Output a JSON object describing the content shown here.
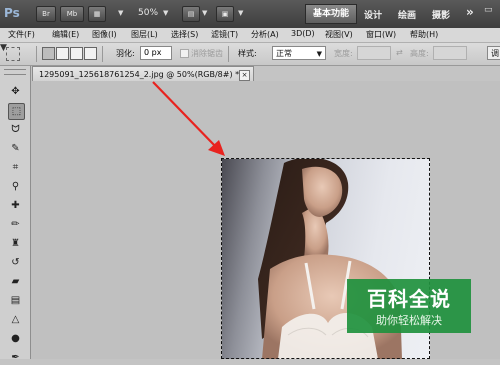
{
  "app": {
    "logo": "Ps",
    "bridge_label": "Br",
    "minibridge_label": "Mb",
    "zoom": "50%"
  },
  "workspaces": {
    "active": "基本功能",
    "items": [
      "设计",
      "绘画",
      "摄影"
    ],
    "more": "»"
  },
  "menu": {
    "items": [
      "文件(F)",
      "编辑(E)",
      "图像(I)",
      "图层(L)",
      "选择(S)",
      "滤镜(T)",
      "分析(A)",
      "3D(D)",
      "视图(V)",
      "窗口(W)",
      "帮助(H)"
    ]
  },
  "options": {
    "feather_label": "羽化:",
    "feather_value": "0 px",
    "antialias_label": "消除锯齿",
    "style_label": "样式:",
    "style_value": "正常",
    "width_label": "宽度:",
    "height_label": "高度:",
    "refine_label": "调"
  },
  "document": {
    "tab_title": "1295091_125618761254_2.jpg @ 50%(RGB/8#) *",
    "close": "×"
  },
  "tools": [
    "move-tool",
    "marquee-tool",
    "lasso-tool",
    "quick-selection-tool",
    "crop-tool",
    "eyedropper-tool",
    "healing-brush-tool",
    "brush-tool",
    "clone-stamp-tool",
    "history-brush-tool",
    "eraser-tool",
    "gradient-tool",
    "blur-tool",
    "dodge-tool",
    "pen-tool",
    "type-tool"
  ],
  "watermark": {
    "title": "百科全说",
    "subtitle": "助你轻松解决"
  },
  "colors": {
    "appbar": "#4a4a4a",
    "arrow": "#e8231f",
    "watermark": "#20913e"
  }
}
